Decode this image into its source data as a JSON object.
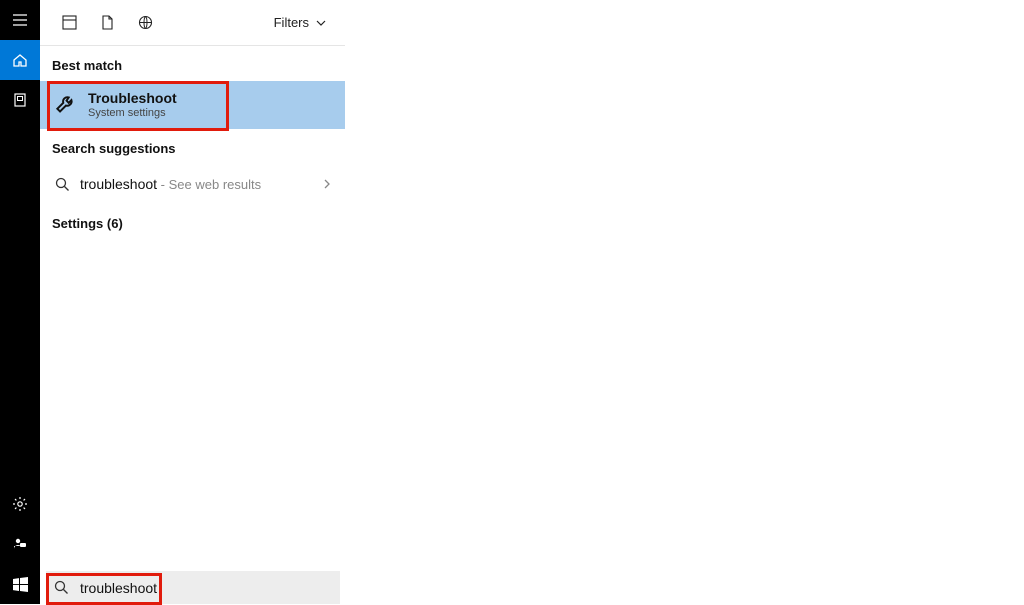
{
  "filters_label": "Filters",
  "best_match_label": "Best match",
  "best_match": {
    "title": "Troubleshoot",
    "subtitle": "System settings"
  },
  "search_suggestions_label": "Search suggestions",
  "suggestion": {
    "term": "troubleshoot",
    "tail": " - See web results"
  },
  "settings_label": "Settings (6)",
  "search_value": "troubleshoot"
}
